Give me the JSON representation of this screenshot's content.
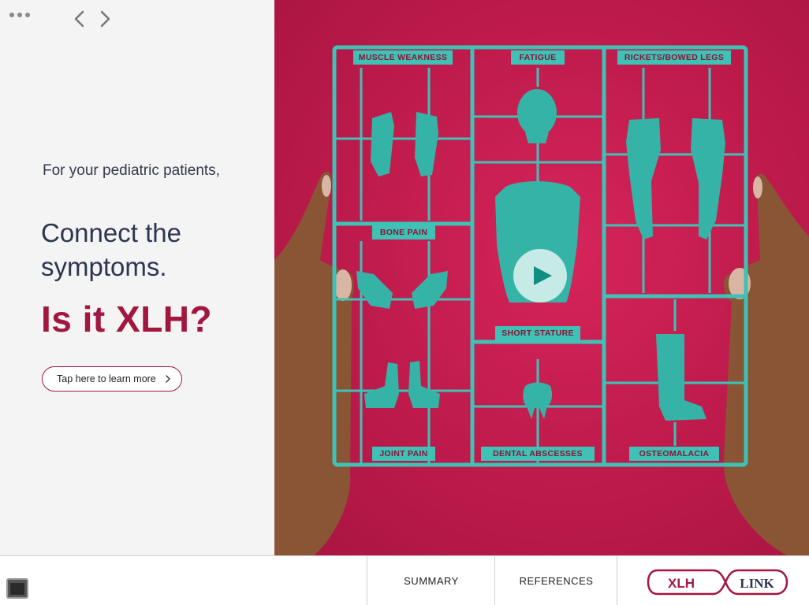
{
  "nav": {
    "more_icon": "more-dots-icon",
    "back_icon": "chevron-left-icon",
    "forward_icon": "chevron-right-icon"
  },
  "left": {
    "lead": "For your pediatric patients,",
    "headline": "Connect the symptoms.",
    "question": "Is it XLH?",
    "cta_label": "Tap here to learn more"
  },
  "hero": {
    "labels": {
      "muscle_weakness": "MUSCLE WEAKNESS",
      "fatigue": "FATIGUE",
      "rickets": "RICKETS/BOWED LEGS",
      "bone_pain": "BONE PAIN",
      "short_stature": "SHORT STATURE",
      "joint_pain": "JOINT PAIN",
      "dental": "DENTAL ABSCESSES",
      "osteomalacia": "OSTEOMALACIA"
    },
    "play_icon": "play-icon"
  },
  "bottom": {
    "summary": "SUMMARY",
    "references": "REFERENCES",
    "logo_left": "XLH",
    "logo_right": "LINK"
  },
  "colors": {
    "brand_crimson": "#a3173f",
    "hero_red": "#c11c4e",
    "kit_teal": "#3fc1b5",
    "navy_text": "#2d3550"
  }
}
